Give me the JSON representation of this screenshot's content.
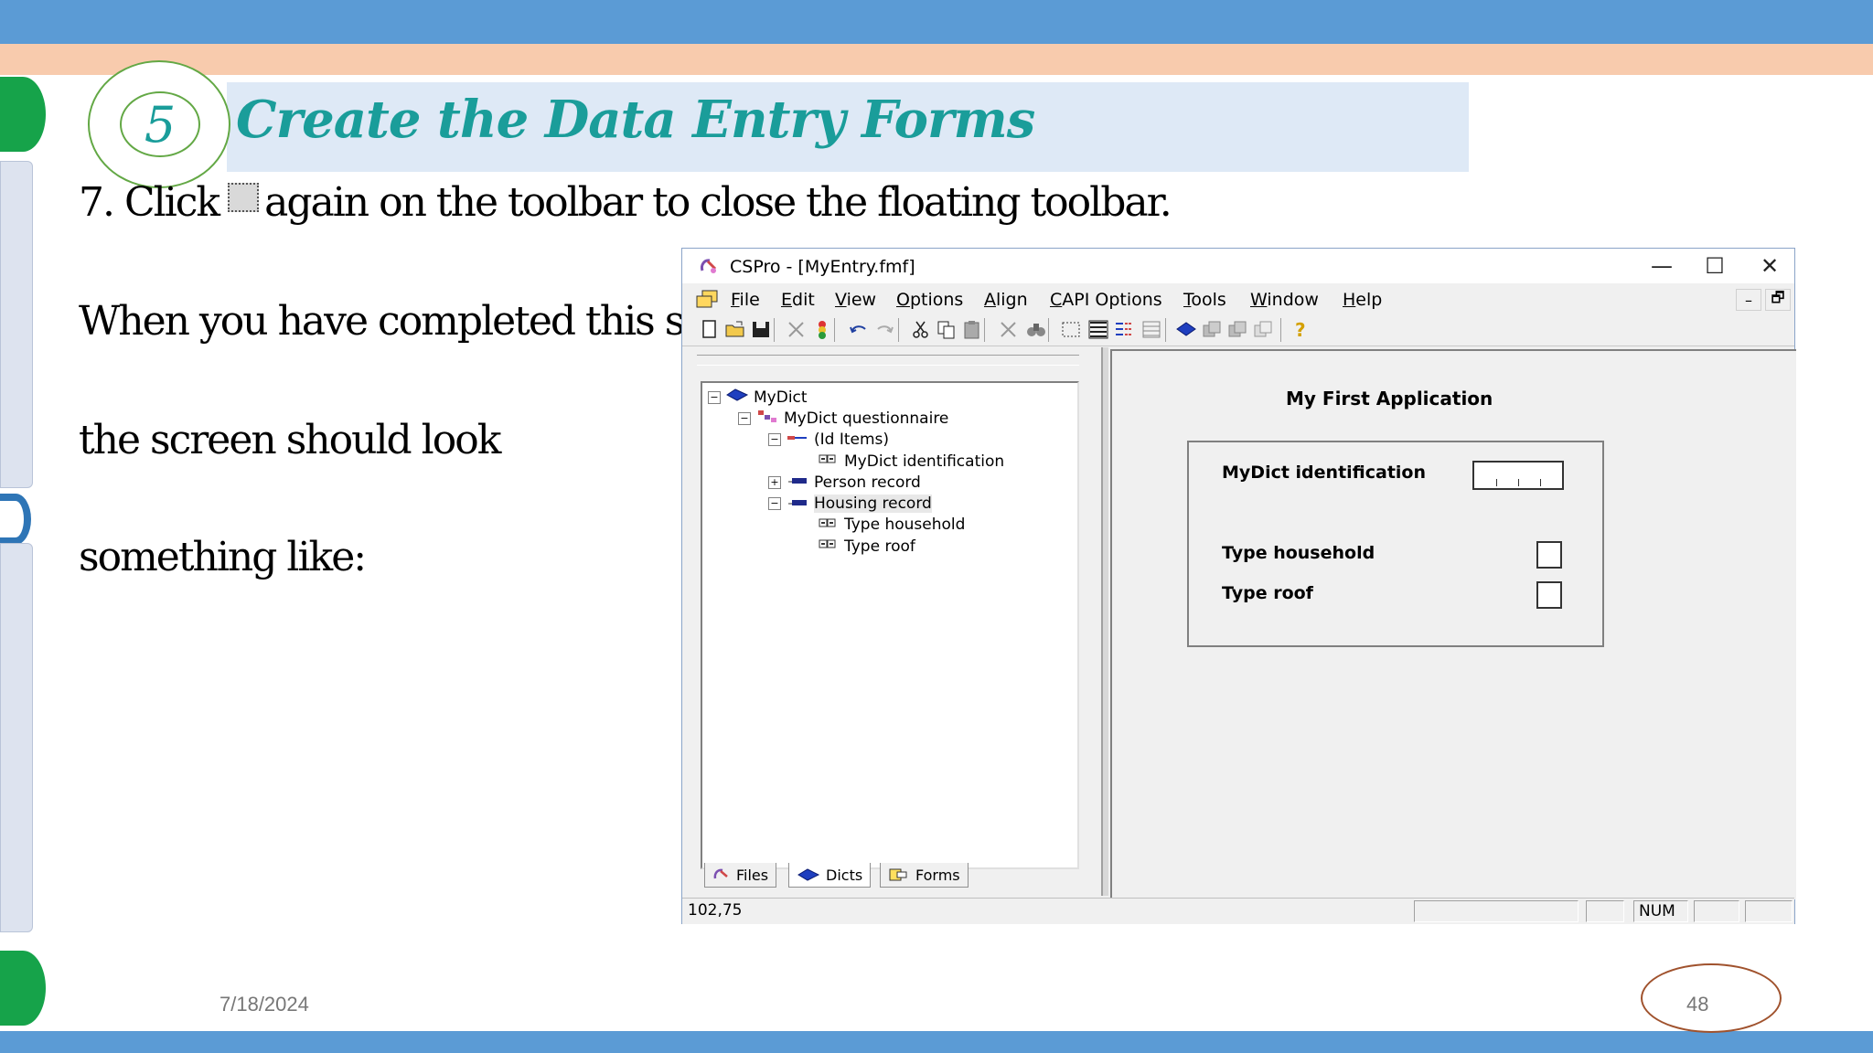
{
  "slide": {
    "step_number": "5",
    "title": "Create the Data Entry Forms",
    "instruction_prefix": "7. Click",
    "instruction_suffix": "again on the toolbar to close the floating toolbar.",
    "body_line1": "When you have completed this step",
    "body_line2": "the screen should look",
    "body_line3": "something like:",
    "date": "7/18/2024",
    "page_number": "48"
  },
  "window": {
    "title": "CSPro - [MyEntry.fmf]",
    "minimize_glyph": "—",
    "maximize_glyph": "☐",
    "close_glyph": "✕",
    "mdi_minimize_glyph": "–",
    "mdi_restore_glyph": "🗗"
  },
  "menu": [
    "File",
    "Edit",
    "View",
    "Options",
    "Align",
    "CAPI Options",
    "Tools",
    "Window",
    "Help"
  ],
  "toolbar_icons": [
    "new-icon",
    "open-icon",
    "save-icon",
    "generate-icon",
    "run-icon",
    "undo-icon",
    "redo-icon",
    "cut-icon",
    "copy-icon",
    "paste-icon",
    "delete-icon",
    "find-icon",
    "box-select-icon",
    "field-props-icon",
    "roster-icon",
    "grid-icon",
    "dictionary-icon",
    "form-icon",
    "form2-icon",
    "form3-icon",
    "help-icon"
  ],
  "tree": [
    {
      "label": "MyDict",
      "level": 0,
      "expander": "−",
      "icon": "dict-book-icon"
    },
    {
      "label": "MyDict questionnaire",
      "level": 1,
      "expander": "−",
      "icon": "questionnaire-icon"
    },
    {
      "label": "(Id Items)",
      "level": 2,
      "expander": "−",
      "icon": "id-items-icon"
    },
    {
      "label": "MyDict identification",
      "level": 3,
      "expander": "",
      "icon": "field-icon"
    },
    {
      "label": "Person record",
      "level": 2,
      "expander": "+",
      "icon": "record-icon"
    },
    {
      "label": "Housing record",
      "level": 2,
      "expander": "−",
      "icon": "record-icon",
      "selected": true
    },
    {
      "label": "Type household",
      "level": 3,
      "expander": "",
      "icon": "field-icon"
    },
    {
      "label": "Type roof",
      "level": 3,
      "expander": "",
      "icon": "field-icon"
    }
  ],
  "tabs": [
    "Files",
    "Dicts",
    "Forms"
  ],
  "form": {
    "title": "My First Application",
    "id_label": "MyDict identification",
    "field1_label": "Type household",
    "field2_label": "Type roof"
  },
  "status": {
    "coords": "102,75",
    "num": "NUM"
  },
  "colors": {
    "accent_teal": "#1a9d9a",
    "top_bar": "#5b9bd5",
    "peach_bar": "#f8cbad"
  }
}
